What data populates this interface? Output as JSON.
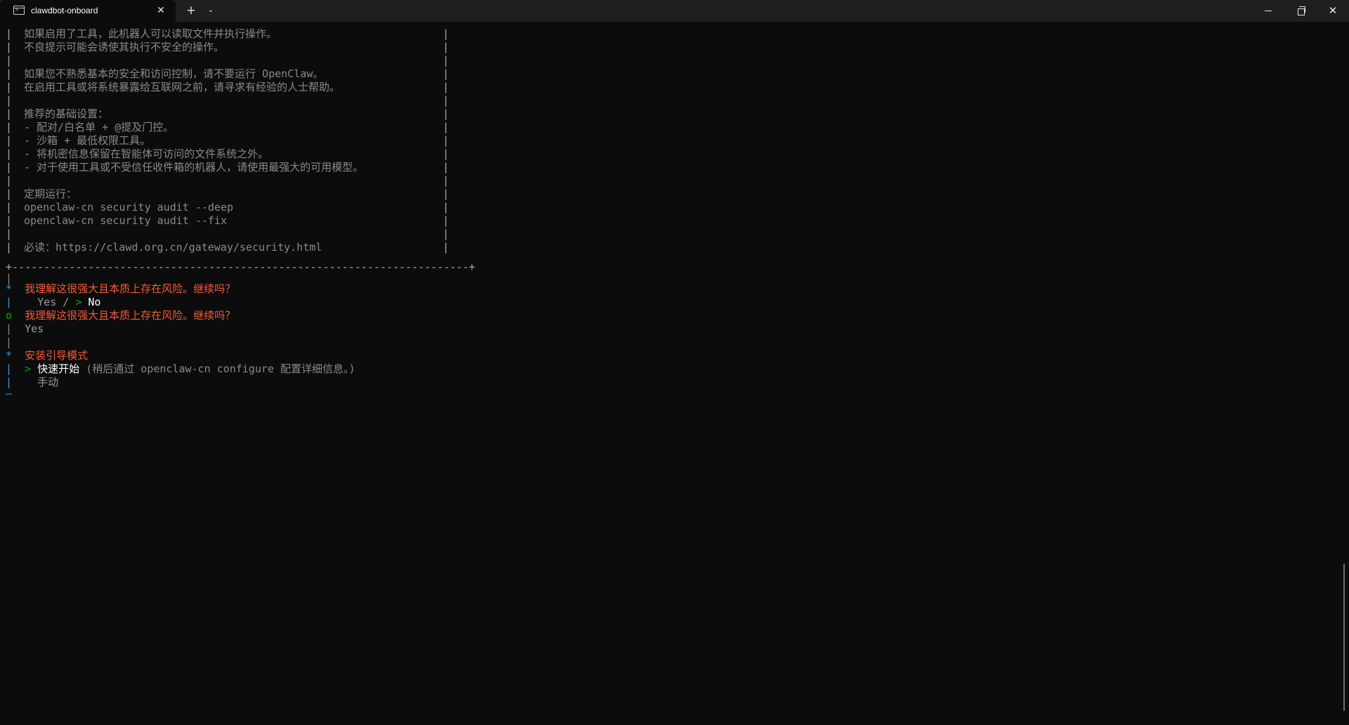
{
  "window": {
    "tab_title": "clawdbot-onboard",
    "new_tab_glyph": "+",
    "dropdown_glyph": "⌄",
    "close_tab_glyph": "✕",
    "close_window_glyph": "✕"
  },
  "icons": {
    "tab": "terminal-icon",
    "close_tab": "close-icon",
    "new_tab": "plus-icon",
    "dropdown": "chevron-down-icon",
    "minimize": "minimize-icon",
    "maximize": "restore-icon",
    "close_window": "close-icon"
  },
  "terminal": {
    "box_lines": [
      "如果启用了工具，此机器人可以读取文件并执行操作。",
      "不良提示可能会诱使其执行不安全的操作。",
      "",
      "如果您不熟悉基本的安全和访问控制，请不要运行 OpenClaw。",
      "在启用工具或将系统暴露给互联网之前，请寻求有经验的人士帮助。",
      "",
      "推荐的基础设置：",
      "- 配对/白名单 + @提及门控。",
      "- 沙箱 + 最低权限工具。",
      "- 将机密信息保留在智能体可访问的文件系统之外。",
      "- 对于使用工具或不受信任收件箱的机器人，请使用最强大的可用模型。",
      "",
      "定期运行：",
      "openclaw-cn security audit --deep",
      "openclaw-cn security audit --fix",
      "",
      "必读：https://clawd.org.cn/gateway/security.html"
    ],
    "box_bottom": "+------------------------------------------------------------------------+",
    "prompt1": {
      "marker": "*",
      "question": "我理解这很强大且本质上存在风险。继续吗？",
      "option_yes": "Yes",
      "separator": " / ",
      "pointer": ">",
      "option_no": "No"
    },
    "answer1": {
      "marker": "o",
      "question": "我理解这很强大且本质上存在风险。继续吗？",
      "value": "Yes"
    },
    "prompt2": {
      "marker": "*",
      "title": "安装引导模式",
      "pointer": ">",
      "option1": "快速开始",
      "option1_hint": "(稍后通过 openclaw-cn configure 配置详细信息。)",
      "option2": "手动",
      "end_marker": "—"
    }
  }
}
